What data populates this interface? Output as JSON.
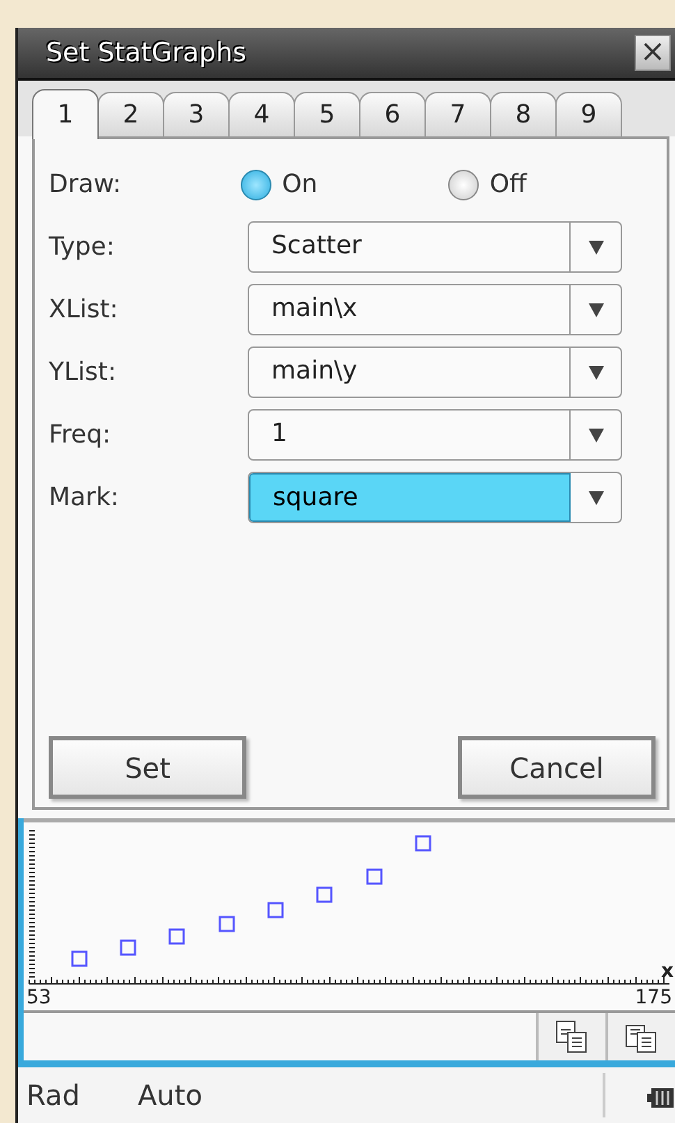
{
  "window": {
    "title": "Set StatGraphs",
    "close": "×"
  },
  "tabs": [
    {
      "label": "1",
      "selected": true
    },
    {
      "label": "2",
      "selected": false
    },
    {
      "label": "3",
      "selected": false
    },
    {
      "label": "4",
      "selected": false
    },
    {
      "label": "5",
      "selected": false
    },
    {
      "label": "6",
      "selected": false
    },
    {
      "label": "7",
      "selected": false
    },
    {
      "label": "8",
      "selected": false
    },
    {
      "label": "9",
      "selected": false
    }
  ],
  "draw": {
    "label": "Draw:",
    "options": [
      {
        "label": "On",
        "selected": true
      },
      {
        "label": "Off",
        "selected": false
      }
    ]
  },
  "fields": [
    {
      "label": "Type:",
      "value": "Scatter",
      "highlighted": false
    },
    {
      "label": "XList:",
      "value": "main\\x",
      "highlighted": false
    },
    {
      "label": "YList:",
      "value": "main\\y",
      "highlighted": false
    },
    {
      "label": "Freq:",
      "value": "1",
      "highlighted": false
    },
    {
      "label": "Mark:",
      "value": "square",
      "highlighted": true
    }
  ],
  "buttons": [
    "Set",
    "Cancel"
  ],
  "graph": {
    "x_min": "53",
    "x_max": "175",
    "axis_label": "x"
  },
  "status_bar": {
    "angle": "Rad",
    "mode": "Auto"
  }
}
